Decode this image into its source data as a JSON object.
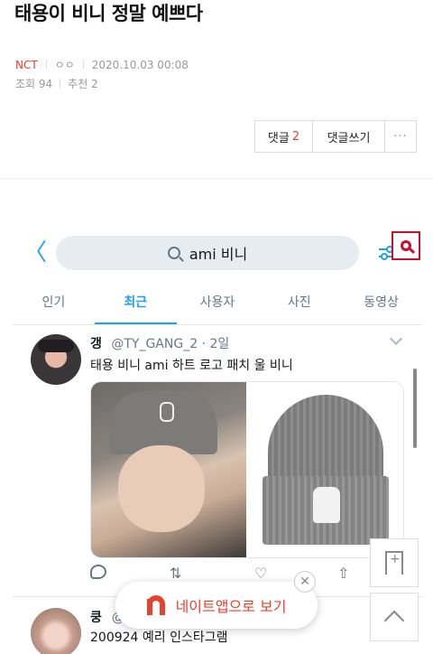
{
  "post": {
    "title": "태용이 비니 정말 예쁘다",
    "board": "NCT",
    "author": "ㅇㅇ",
    "datetime": "2020.10.03 00:08",
    "views": "조회 94",
    "likes": "추천 2"
  },
  "buttons": {
    "comment_label": "댓글",
    "comment_count": "2",
    "write_comment": "댓글쓰기",
    "more": "···"
  },
  "twitter": {
    "back": "〈",
    "search_query": "ami 비니",
    "tabs": [
      "인기",
      "최근",
      "사용자",
      "사진",
      "동영상"
    ],
    "active_tab": "최근",
    "tweets": [
      {
        "name": "갱",
        "handle_time": "@TY_GANG_2 · 2일",
        "text": "태용 비니 ami 하트 로고 패치 울 비니"
      },
      {
        "name": "쿵",
        "handle_time": "@",
        "text": "200924 예리 인스타그램"
      }
    ]
  },
  "app_banner": {
    "label": "네이트앱으로 보기"
  },
  "icons": {
    "close": "✕",
    "retweet": "⇅",
    "like": "♡",
    "share": "⇧"
  },
  "colors": {
    "accent_red": "#e8412c",
    "twitter_blue": "#1da1f2"
  }
}
